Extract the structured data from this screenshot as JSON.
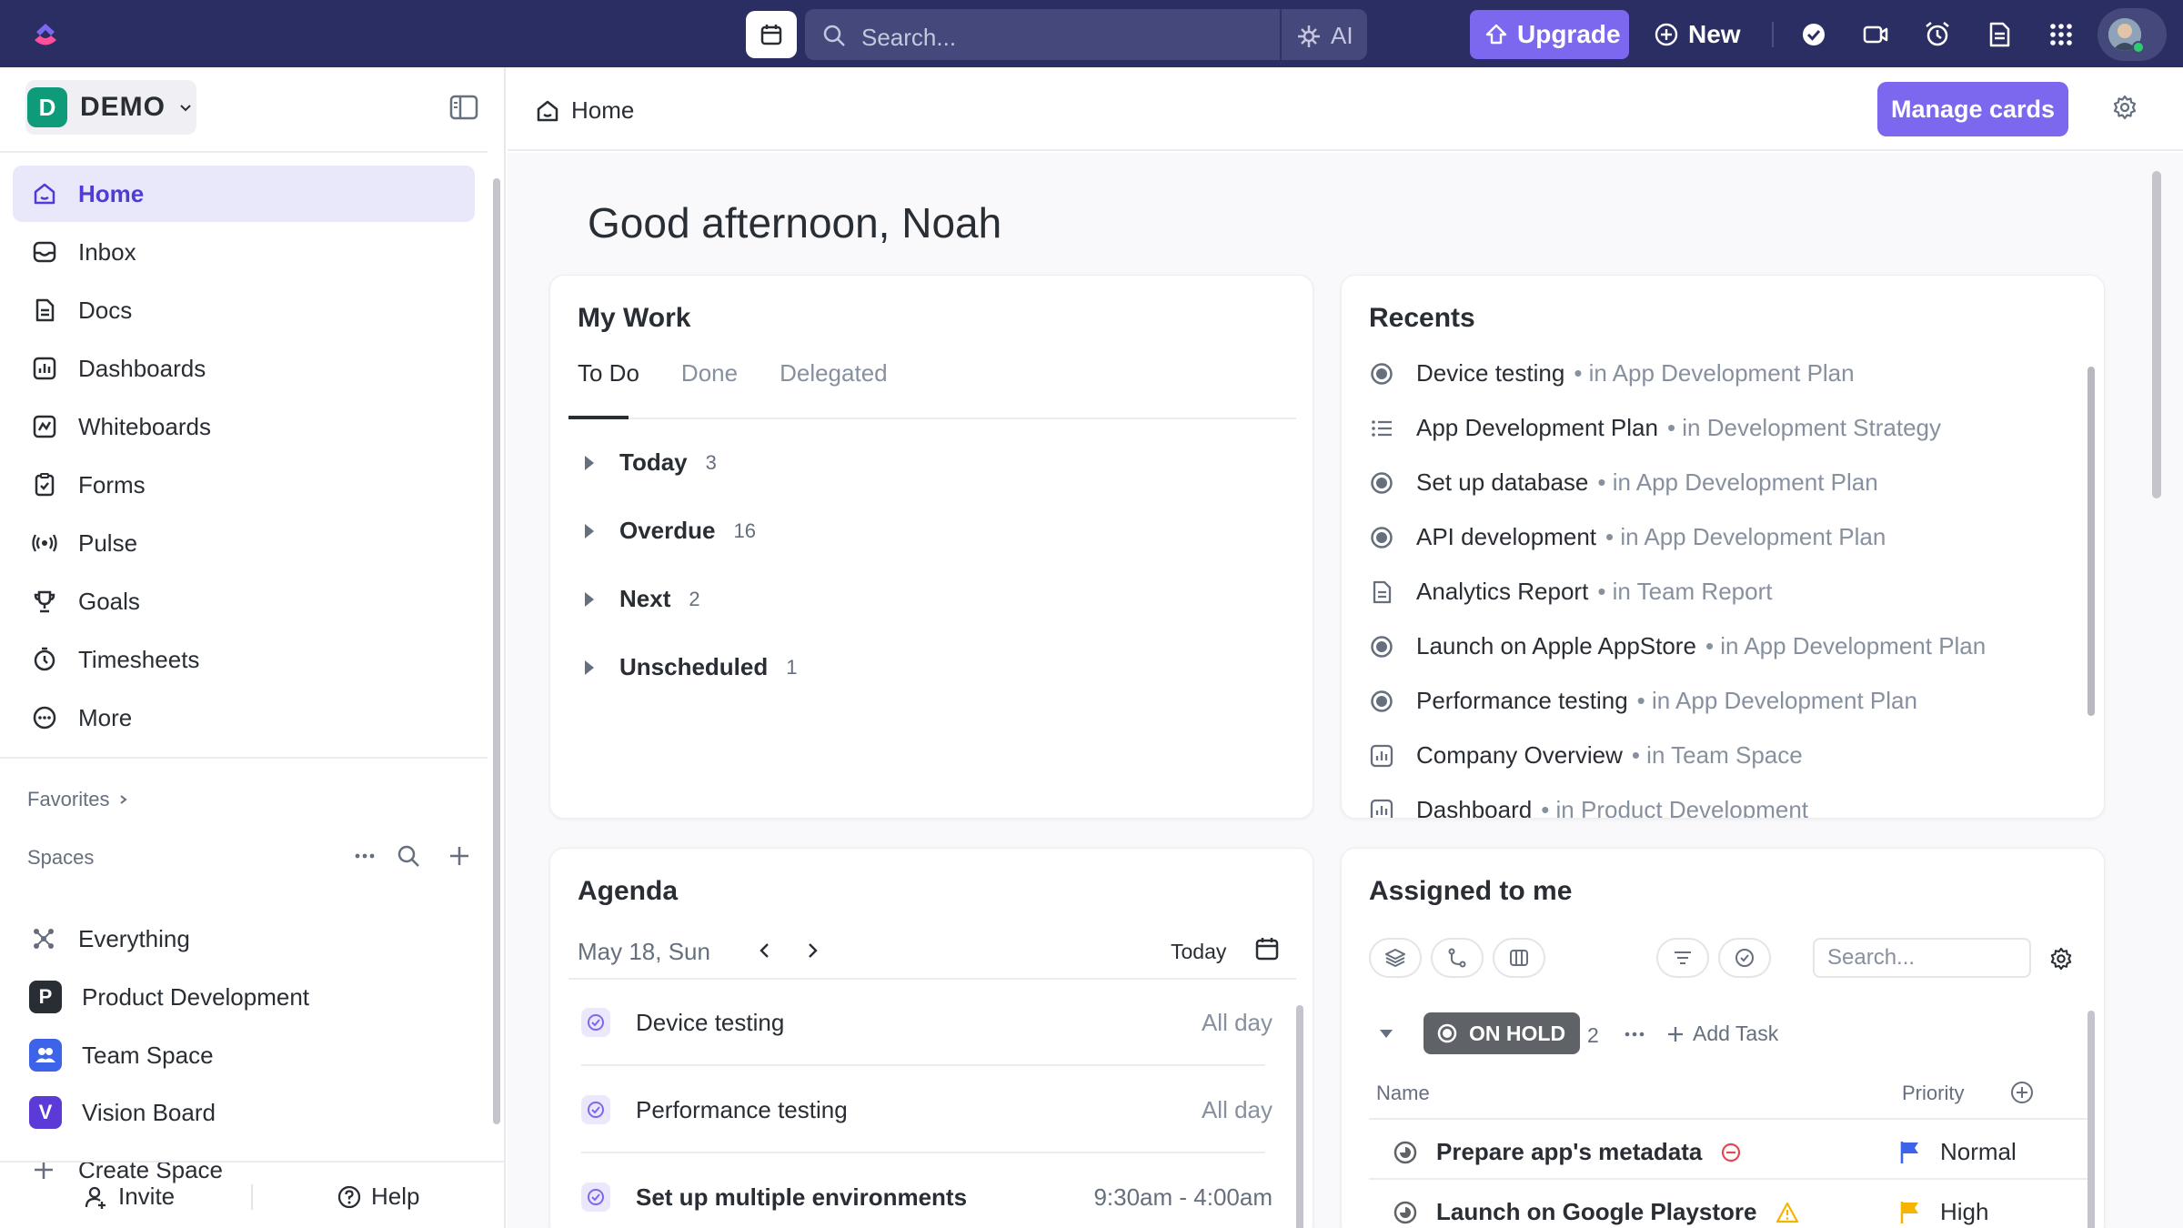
{
  "topbar": {
    "search_placeholder": "Search...",
    "ai_label": "AI",
    "upgrade_label": "Upgrade",
    "new_label": "New"
  },
  "workspace": {
    "badge": "D",
    "name": "DEMO"
  },
  "sidebar": {
    "nav": [
      {
        "label": "Home",
        "icon": "home-icon",
        "active": true
      },
      {
        "label": "Inbox",
        "icon": "inbox-icon"
      },
      {
        "label": "Docs",
        "icon": "docs-icon"
      },
      {
        "label": "Dashboards",
        "icon": "dashboards-icon"
      },
      {
        "label": "Whiteboards",
        "icon": "whiteboards-icon"
      },
      {
        "label": "Forms",
        "icon": "forms-icon"
      },
      {
        "label": "Pulse",
        "icon": "pulse-icon"
      },
      {
        "label": "Goals",
        "icon": "trophy-icon"
      },
      {
        "label": "Timesheets",
        "icon": "timesheets-icon"
      },
      {
        "label": "More",
        "icon": "more-icon"
      }
    ],
    "favorites_label": "Favorites",
    "spaces_label": "Spaces",
    "spaces": [
      {
        "label": "Everything",
        "badge": "",
        "color": ""
      },
      {
        "label": "Product Development",
        "badge": "P",
        "color": "#292d34"
      },
      {
        "label": "Team Space",
        "badge": "",
        "color": "#3d63e8"
      },
      {
        "label": "Vision Board",
        "badge": "V",
        "color": "#5b3ad8"
      }
    ],
    "create_space_label": "Create Space",
    "invite_label": "Invite",
    "help_label": "Help"
  },
  "header": {
    "breadcrumb": "Home",
    "manage_cards_label": "Manage cards"
  },
  "greeting": "Good afternoon, Noah",
  "my_work": {
    "title": "My Work",
    "tabs": [
      "To Do",
      "Done",
      "Delegated"
    ],
    "groups": [
      {
        "name": "Today",
        "count": "3"
      },
      {
        "name": "Overdue",
        "count": "16"
      },
      {
        "name": "Next",
        "count": "2"
      },
      {
        "name": "Unscheduled",
        "count": "1"
      }
    ]
  },
  "recents": {
    "title": "Recents",
    "items": [
      {
        "name": "Device testing",
        "location": "• in App Development Plan",
        "icon": "task-icon"
      },
      {
        "name": "App Development Plan",
        "location": "• in Development Strategy",
        "icon": "list-icon"
      },
      {
        "name": "Set up database",
        "location": "• in App Development Plan",
        "icon": "task-icon"
      },
      {
        "name": "API development",
        "location": "• in App Development Plan",
        "icon": "task-icon"
      },
      {
        "name": "Analytics Report",
        "location": "• in Team Report",
        "icon": "doc-icon"
      },
      {
        "name": "Launch on Apple AppStore",
        "location": "• in App Development Plan",
        "icon": "task-icon"
      },
      {
        "name": "Performance testing",
        "location": "• in App Development Plan",
        "icon": "task-icon"
      },
      {
        "name": "Company Overview",
        "location": "• in Team Space",
        "icon": "dashboard-icon"
      },
      {
        "name": "Dashboard",
        "location": "• in Product Development",
        "icon": "dashboard-icon"
      }
    ]
  },
  "agenda": {
    "title": "Agenda",
    "date": "May 18, Sun",
    "today_label": "Today",
    "items": [
      {
        "name": "Device testing",
        "time": "All day"
      },
      {
        "name": "Performance testing",
        "time": "All day"
      },
      {
        "name": "Set up multiple environments",
        "time": "9:30am - 4:00am"
      }
    ]
  },
  "assigned": {
    "title": "Assigned to me",
    "search_placeholder": "Search...",
    "status": "ON HOLD",
    "status_count": "2",
    "add_task_label": "Add Task",
    "col_name": "Name",
    "col_priority": "Priority",
    "tasks": [
      {
        "name": "Prepare app's metadata",
        "priority": "Normal",
        "flag_color": "#3d63e8",
        "badge": "blocked"
      },
      {
        "name": "Launch on Google Playstore",
        "priority": "High",
        "flag_color": "#f5b400",
        "badge": "warning"
      }
    ]
  },
  "colors": {
    "accent": "#7b68ee",
    "topbar": "#2a2e62",
    "workspace": "#0e9b7a"
  }
}
